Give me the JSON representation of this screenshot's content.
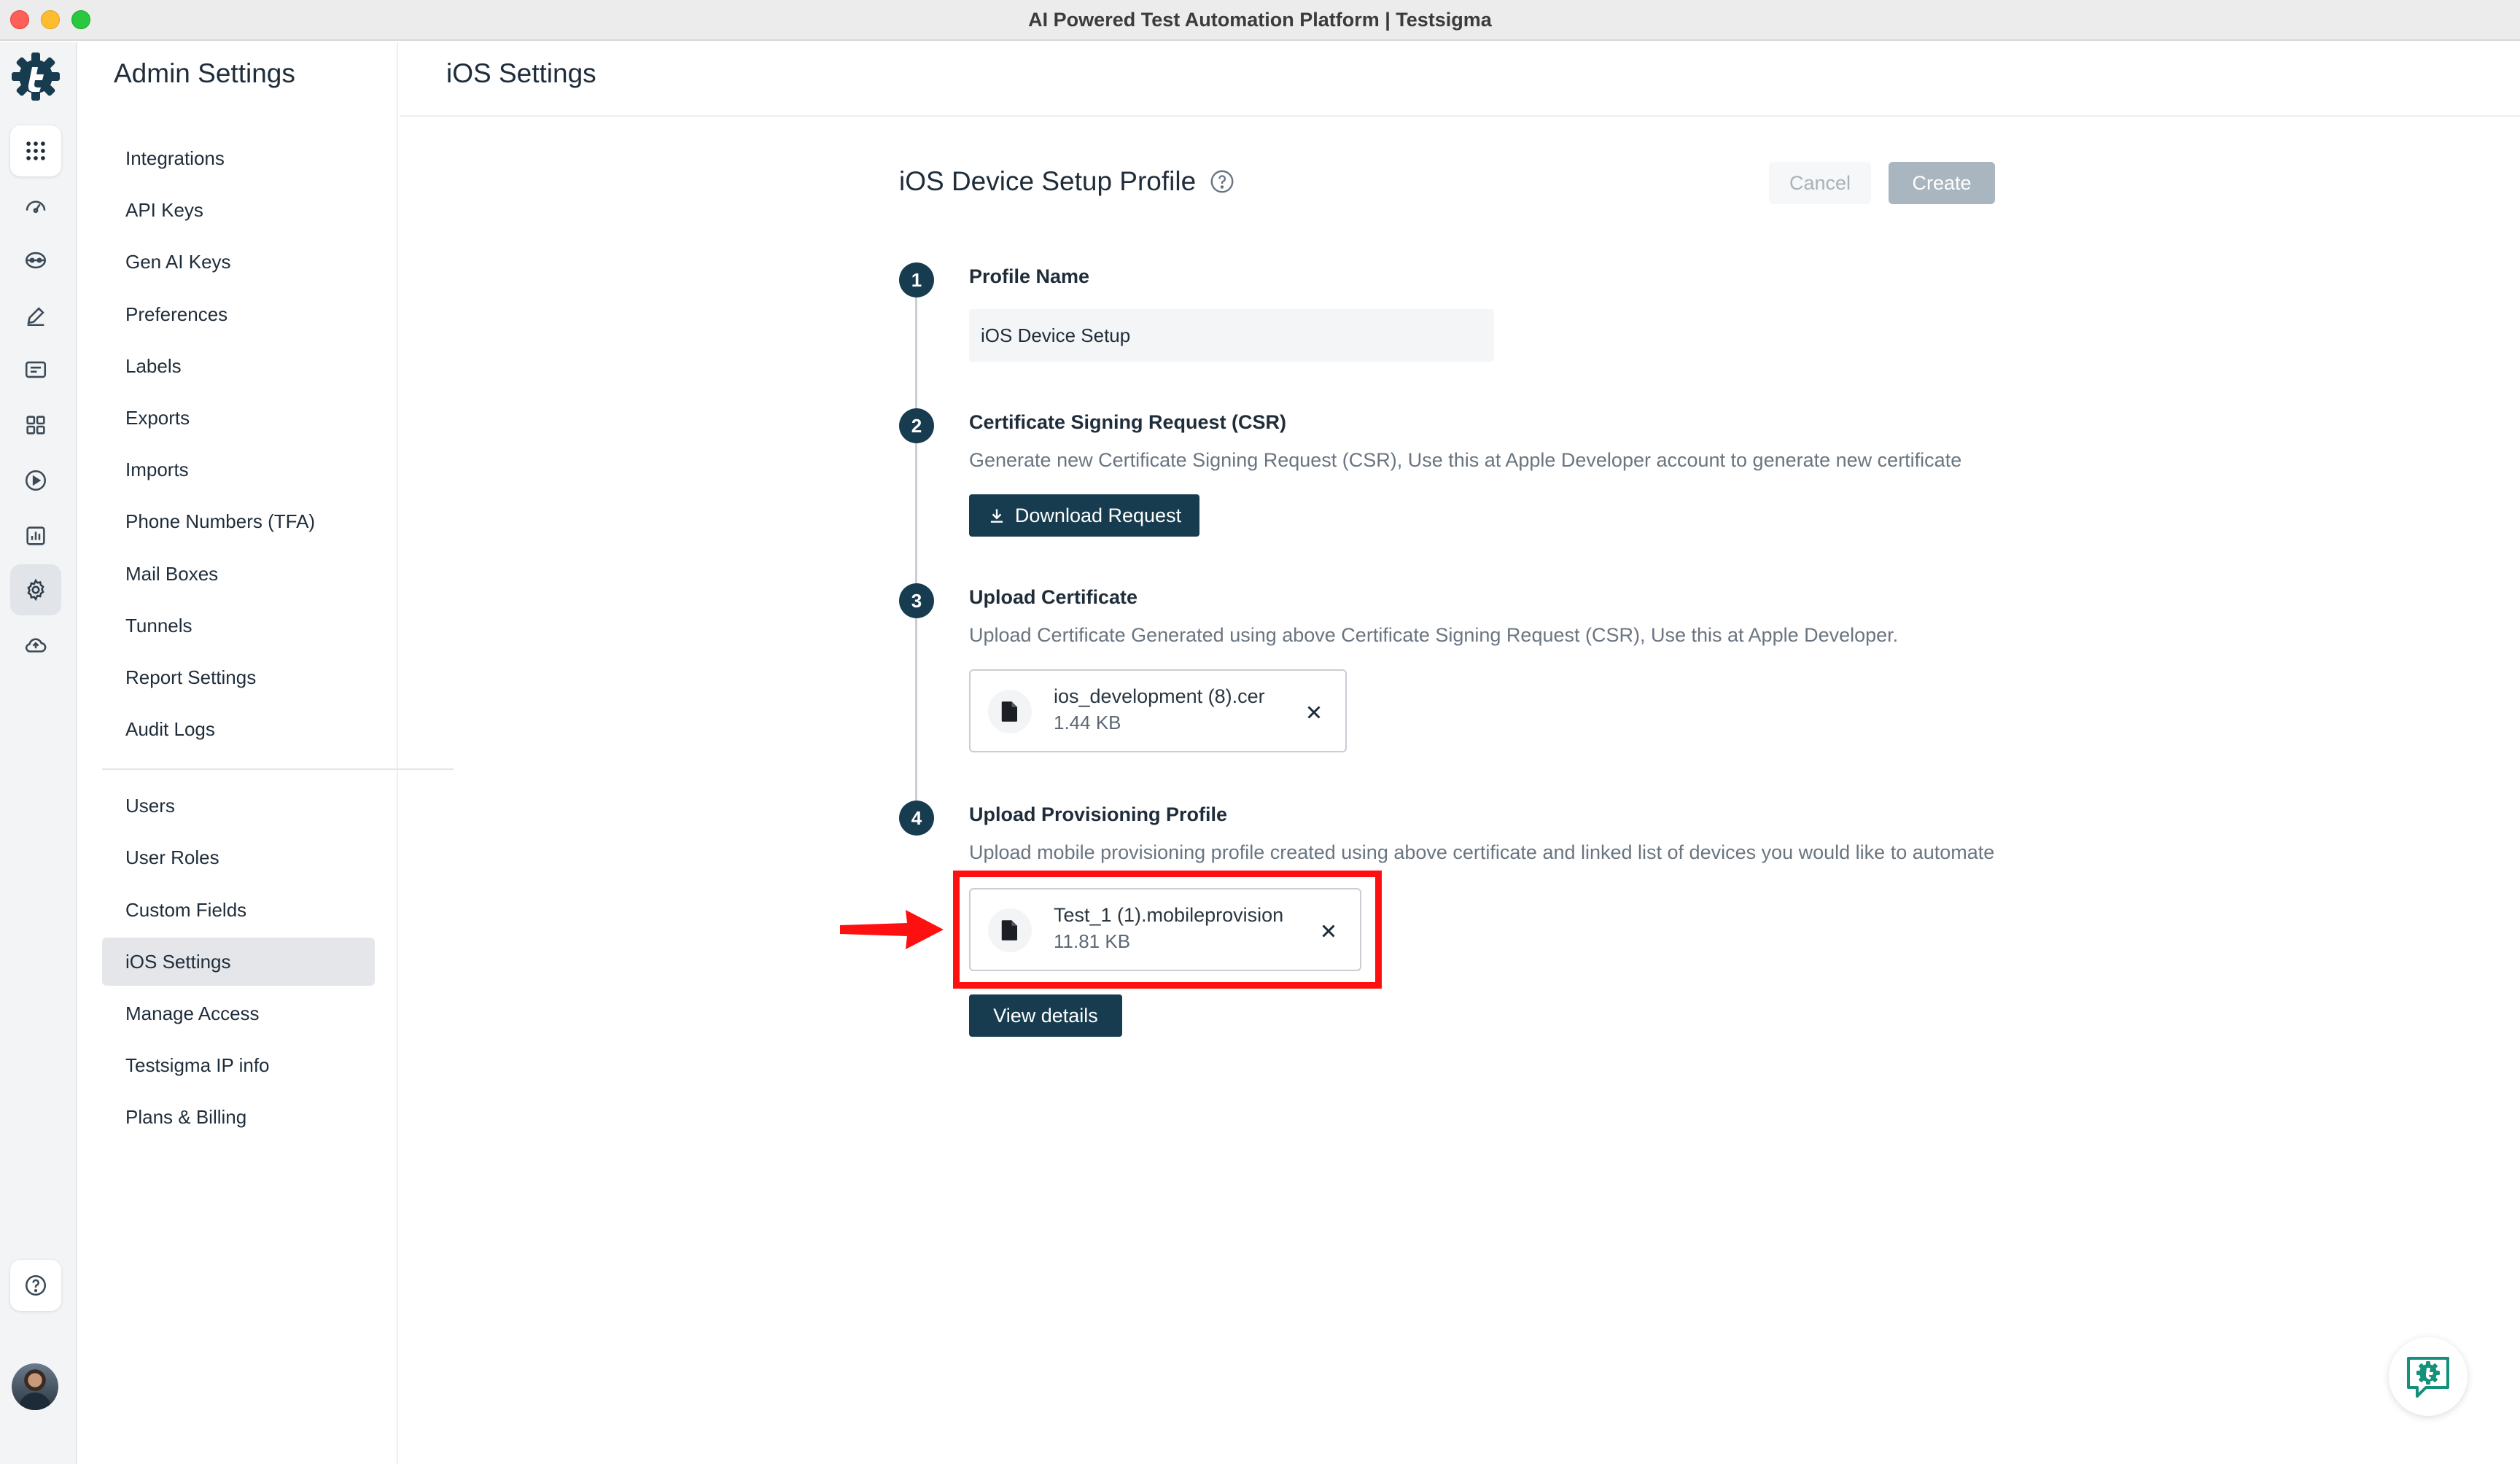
{
  "window": {
    "title": "AI Powered Test Automation Platform | Testsigma"
  },
  "rail": {
    "icons": [
      "apps-grid-icon",
      "dashboard-icon",
      "test-lab-icon",
      "edit-icon",
      "folder-icon",
      "modules-icon",
      "run-icon",
      "reports-icon",
      "settings-icon",
      "cloud-icon",
      "help-icon"
    ]
  },
  "sidebar": {
    "title": "Admin Settings",
    "items": [
      {
        "label": "Integrations"
      },
      {
        "label": "API Keys"
      },
      {
        "label": "Gen AI Keys"
      },
      {
        "label": "Preferences"
      },
      {
        "label": "Labels"
      },
      {
        "label": "Exports"
      },
      {
        "label": "Imports"
      },
      {
        "label": "Phone Numbers (TFA)"
      },
      {
        "label": "Mail Boxes"
      },
      {
        "label": "Tunnels"
      },
      {
        "label": "Report Settings"
      },
      {
        "label": "Audit Logs"
      }
    ],
    "items2": [
      {
        "label": "Users"
      },
      {
        "label": "User Roles"
      },
      {
        "label": "Custom Fields"
      },
      {
        "label": "iOS Settings",
        "active": true
      },
      {
        "label": "Manage Access"
      },
      {
        "label": "Testsigma IP info"
      },
      {
        "label": "Plans & Billing"
      }
    ]
  },
  "main": {
    "header": "iOS Settings",
    "form_title": "iOS Device Setup Profile",
    "cancel_label": "Cancel",
    "create_label": "Create",
    "steps": [
      {
        "num": "1",
        "title": "Profile Name",
        "input_value": "iOS Device Setup"
      },
      {
        "num": "2",
        "title": "Certificate Signing Request (CSR)",
        "desc": "Generate new Certificate Signing Request (CSR), Use this at Apple Developer account to generate new certificate",
        "button": "Download Request"
      },
      {
        "num": "3",
        "title": "Upload Certificate",
        "desc": "Upload Certificate Generated using above Certificate Signing Request (CSR), Use this at Apple Developer.",
        "file": {
          "name": "ios_development (8).cer",
          "size": "1.44 KB"
        }
      },
      {
        "num": "4",
        "title": "Upload Provisioning Profile",
        "desc": "Upload mobile provisioning profile created using above certificate and linked list of devices you would like to automate",
        "file": {
          "name": "Test_1 (1).mobileprovision",
          "size": "11.81 KB"
        },
        "button": "View details"
      }
    ]
  },
  "colors": {
    "primary": "#173c4f",
    "annotation": "#ff1010",
    "brand": "#15907a"
  }
}
